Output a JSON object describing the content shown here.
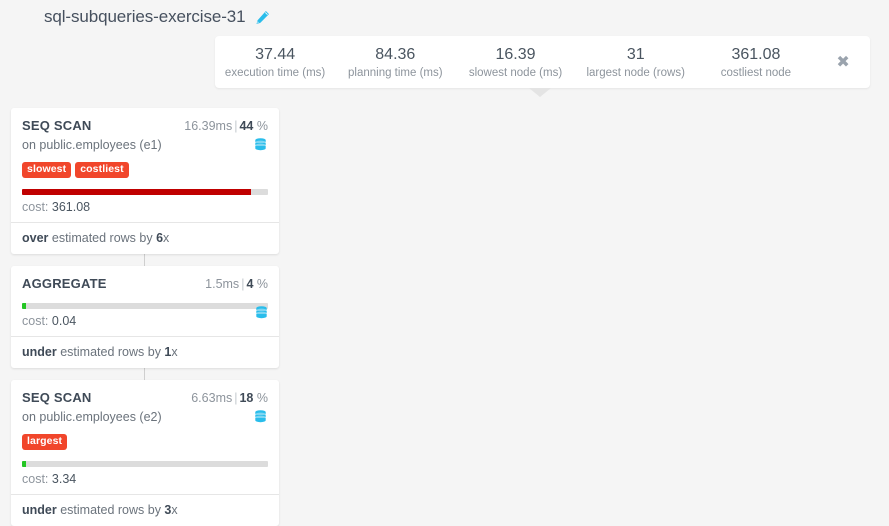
{
  "header": {
    "plan_title": "sql-subqueries-exercise-31",
    "edit_icon": "pencil-icon"
  },
  "stats": {
    "close_label": "✖",
    "items": [
      {
        "value": "37.44",
        "label": "execution time (ms)"
      },
      {
        "value": "84.36",
        "label": "planning time (ms)"
      },
      {
        "value": "16.39",
        "label": "slowest node (ms)"
      },
      {
        "value": "31",
        "label": "largest node (rows)"
      },
      {
        "value": "361.08",
        "label": "costliest node"
      }
    ]
  },
  "colors": {
    "badge": "#f1462b",
    "bar_red": "#c00000",
    "bar_green": "#24c624",
    "track": "#dcdcdc",
    "accent_cyan": "#29bdeb"
  },
  "nodes": [
    {
      "type": "SEQ SCAN",
      "duration": "16.39ms",
      "separator": "|",
      "percent": "44",
      "percent_unit": "%",
      "relation": "on public.employees (e1)",
      "badges": [
        "slowest",
        "costliest"
      ],
      "bar_percent": 93,
      "bar_color": "#c00000",
      "cost_label": "cost:",
      "cost_value": "361.08",
      "estimate_prefix": "over",
      "estimate_text": " estimated rows by ",
      "estimate_factor": "6",
      "estimate_suffix": "x"
    },
    {
      "type": "AGGREGATE",
      "duration": "1.5ms",
      "separator": "|",
      "percent": "4",
      "percent_unit": "%",
      "relation": "",
      "badges": [],
      "bar_percent": 1.5,
      "bar_color": "#24c624",
      "cost_label": "cost:",
      "cost_value": "0.04",
      "estimate_prefix": "under",
      "estimate_text": " estimated rows by ",
      "estimate_factor": "1",
      "estimate_suffix": "x"
    },
    {
      "type": "SEQ SCAN",
      "duration": "6.63ms",
      "separator": "|",
      "percent": "18",
      "percent_unit": "%",
      "relation": "on public.employees (e2)",
      "badges": [
        "largest"
      ],
      "bar_percent": 1.8,
      "bar_color": "#24c624",
      "cost_label": "cost:",
      "cost_value": "3.34",
      "estimate_prefix": "under",
      "estimate_text": " estimated rows by ",
      "estimate_factor": "3",
      "estimate_suffix": "x"
    }
  ]
}
